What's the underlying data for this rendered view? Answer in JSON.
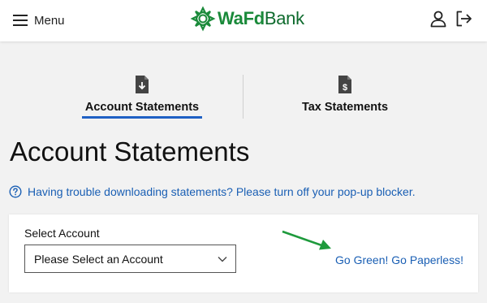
{
  "header": {
    "menu_label": "Menu",
    "logo_wafd": "WaFd",
    "logo_bank": "Bank",
    "brand_color": "#1a8a3a",
    "icons": [
      "hamburger-icon",
      "user-icon",
      "logout-icon"
    ]
  },
  "tabs": [
    {
      "label": "Account Statements",
      "icon": "download-document-icon",
      "active": true
    },
    {
      "label": "Tax Statements",
      "icon": "tax-document-icon",
      "active": false
    }
  ],
  "page": {
    "title": "Account Statements",
    "help_text": "Having trouble downloading statements? Please turn off your pop-up blocker."
  },
  "account_card": {
    "select_label": "Select Account",
    "select_value": "Please Select an Account",
    "paperless_link": "Go Green! Go Paperless!"
  },
  "colors": {
    "link": "#1a5fb4",
    "active_tab_underline": "#1f60c4",
    "annotation_arrow": "#1e9a3c"
  }
}
